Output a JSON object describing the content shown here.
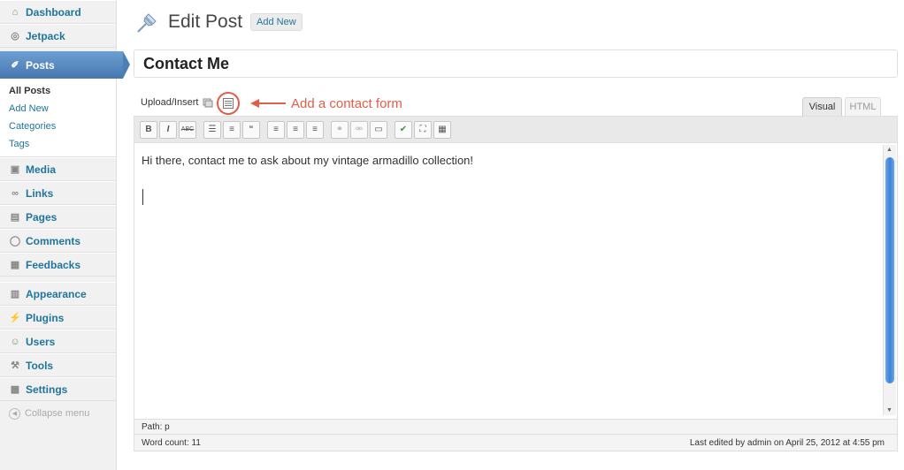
{
  "sidebar": {
    "items": [
      {
        "label": "Dashboard",
        "icon": "dashboard-icon"
      },
      {
        "label": "Jetpack",
        "icon": "jetpack-icon"
      },
      {
        "label": "Posts",
        "icon": "pin-icon"
      },
      {
        "label": "Media",
        "icon": "media-icon"
      },
      {
        "label": "Links",
        "icon": "link-icon"
      },
      {
        "label": "Pages",
        "icon": "pages-icon"
      },
      {
        "label": "Comments",
        "icon": "comments-icon"
      },
      {
        "label": "Feedbacks",
        "icon": "feedback-icon"
      },
      {
        "label": "Appearance",
        "icon": "appearance-icon"
      },
      {
        "label": "Plugins",
        "icon": "plugins-icon"
      },
      {
        "label": "Users",
        "icon": "users-icon"
      },
      {
        "label": "Tools",
        "icon": "tools-icon"
      },
      {
        "label": "Settings",
        "icon": "settings-icon"
      }
    ],
    "posts_submenu": [
      "All Posts",
      "Add New",
      "Categories",
      "Tags"
    ],
    "collapse_label": "Collapse menu"
  },
  "header": {
    "title": "Edit Post",
    "add_new": "Add New"
  },
  "post": {
    "title": "Contact Me",
    "body": "Hi there, contact me to ask about my vintage armadillo collection!"
  },
  "media": {
    "upload_label": "Upload/Insert",
    "annotation": "Add a contact form"
  },
  "tabs": {
    "visual": "Visual",
    "html": "HTML"
  },
  "toolbar_buttons": [
    "bold-icon",
    "italic-icon",
    "strikethrough-icon",
    "bullet-list-icon",
    "numbered-list-icon",
    "blockquote-icon",
    "align-left-icon",
    "align-center-icon",
    "align-right-icon",
    "insert-link-icon",
    "unlink-icon",
    "insert-more-icon",
    "spellcheck-icon",
    "fullscreen-icon",
    "kitchen-sink-icon"
  ],
  "status": {
    "path": "Path: p",
    "word_count": "Word count: 11",
    "last_edited": "Last edited by admin on April 25, 2012 at 4:55 pm"
  },
  "colors": {
    "accent": "#21759b",
    "current_menu": "#4d7fb6",
    "annotation": "#e35d48"
  }
}
